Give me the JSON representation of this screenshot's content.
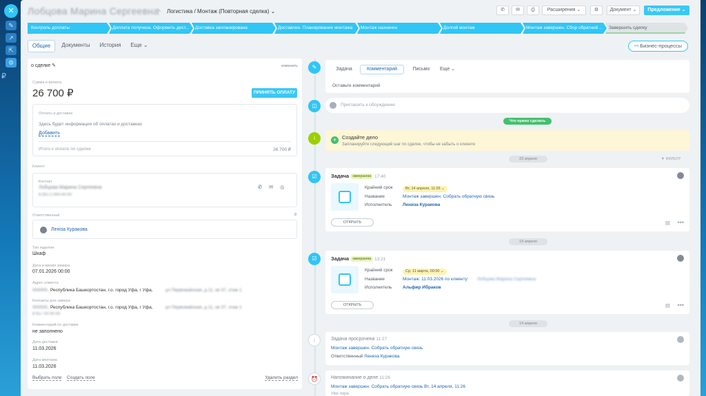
{
  "leftbar": {
    "close": "✕",
    "rub": "₽"
  },
  "header": {
    "title": "Лобцова Марина Сергеевна",
    "breadcrumb": "Логистика / Монтаж (Повторная сделка) ⌄",
    "btn_ext": "Расширения ⌄",
    "btn_doc": "Документ ⌄",
    "btn_offer": "Предложение ⌄"
  },
  "stages": [
    "Контроль доплаты",
    "Доплата получена. Оформить дост...",
    "Доставка запланирована",
    "Доставлен. Планирование монтажа",
    "Монтаж назначен",
    "Долгий монтаж",
    "Монтаж завершен. Сбор обратной ...",
    "Завершить сделку"
  ],
  "tabs": {
    "general": "Общие",
    "docs": "Документы",
    "history": "История",
    "more": "Еще ⌄"
  },
  "bp_button": "Бизнес-процессы",
  "deal": {
    "section": "о сделке ✎",
    "edit": "изменить",
    "amount_label": "Сумма и валюта",
    "amount": "26 700 ₽",
    "pay_button": "ПРИНЯТЬ ОПЛАТУ",
    "pay_title": "Оплаты и доставка",
    "pay_text": "Здесь будет информация об оплатах и доставках",
    "pay_add": "Добавить",
    "total_label": "Итого к оплате по сделке",
    "total_value": "26 700 ₽",
    "client_label": "Клиент",
    "contact_label": "Контакт",
    "contact_name": "Лобцова Марина Сергеевна",
    "contact_phone": "8 (917) 000-00-00",
    "resp_label": "Ответственный",
    "resp_name": "Ленiза Куракова",
    "f1_label": "Тип изделия",
    "f1_value": "Шкаф",
    "f2_label": "Дата и время замера",
    "f2_value": "07.01.2026 00:00",
    "f3_label": "Адрес клиента",
    "f3_prefix": "000000,",
    "f3_value": "Республика Башкортостан, г.о. город Уфа, г Уфа,",
    "f3_suffix": "ул Первомайская, д 11, кв 37, этаж 1",
    "f4_label": "Контакты для замера",
    "f4_prefix": "000000,",
    "f4_value": "Республика Башкортостан, г.о. город Уфа, г Уфа,",
    "f4_suffix": "ул Первомайская, д 11, кв 37, этаж 1",
    "f4_phone": "8 917 00 00 00",
    "f5_label": "Комментарий по доставке",
    "f5_value": "не заполнено",
    "f6_label": "Дата доставки",
    "f6_value": "11.03.2026",
    "f7_label": "Дата монтажа",
    "f7_value": "11.03.2026",
    "choose": "Выбрать поле",
    "create": "Создать поле",
    "delete": "Удалить раздел"
  },
  "timeline": {
    "tab_task": "Задача",
    "tab_comment": "Комментарий",
    "tab_letter": "Письмо",
    "tab_more": "Еще ⌄",
    "comment_placeholder": "Оставьте комментарий",
    "invite": "Пригласить к обсуждению",
    "todo_pill": "Что нужно сделать",
    "create_title": "Создайте дело",
    "create_text": "Запланируйте следующий шаг по сделке, чтобы не забыть о клиенте",
    "date1": "23 апреля",
    "filter": "▼ ФИЛЬТР",
    "task1": {
      "title": "Задача",
      "badge": "завершена",
      "time": "17:40",
      "deadline_label": "Крайний срок",
      "deadline": "Вт, 14 апреля, 11:26 ⌄",
      "name_label": "Название",
      "name": "Монтаж завершен. Собрать обратную связь",
      "exec_label": "Исполнитель",
      "exec": "Лениза Куракова",
      "open": "ОТКРЫТЬ"
    },
    "date2": "19 апреля",
    "task2": {
      "title": "Задача",
      "badge": "завершена",
      "time": "13:21",
      "deadline_label": "Крайний срок",
      "deadline": "Ср, 11 марта, 00:00 ⌄",
      "name_label": "Название",
      "name": "Монтаж: 11.03.2026 по клиенту:",
      "name_blur": "Лобцова Марина Сергеевна",
      "exec_label": "Исполнитель",
      "exec": "Альфир Ибраков",
      "open": "ОТКРЫТЬ"
    },
    "date3": "14 апреля",
    "overdue": {
      "title": "Задача просрочена",
      "time": "11:27",
      "text": "Монтаж завершен. Собрать обратную связь",
      "resp_label": "Ответственный",
      "resp": "Лениза Куракова"
    },
    "reminder": {
      "title": "Напоминание о деле",
      "time": "11:26",
      "text": "Монтаж завершен. Собрать обратную связь Вт, 14 апреля, 11:26",
      "extra": "Уже пора"
    }
  }
}
